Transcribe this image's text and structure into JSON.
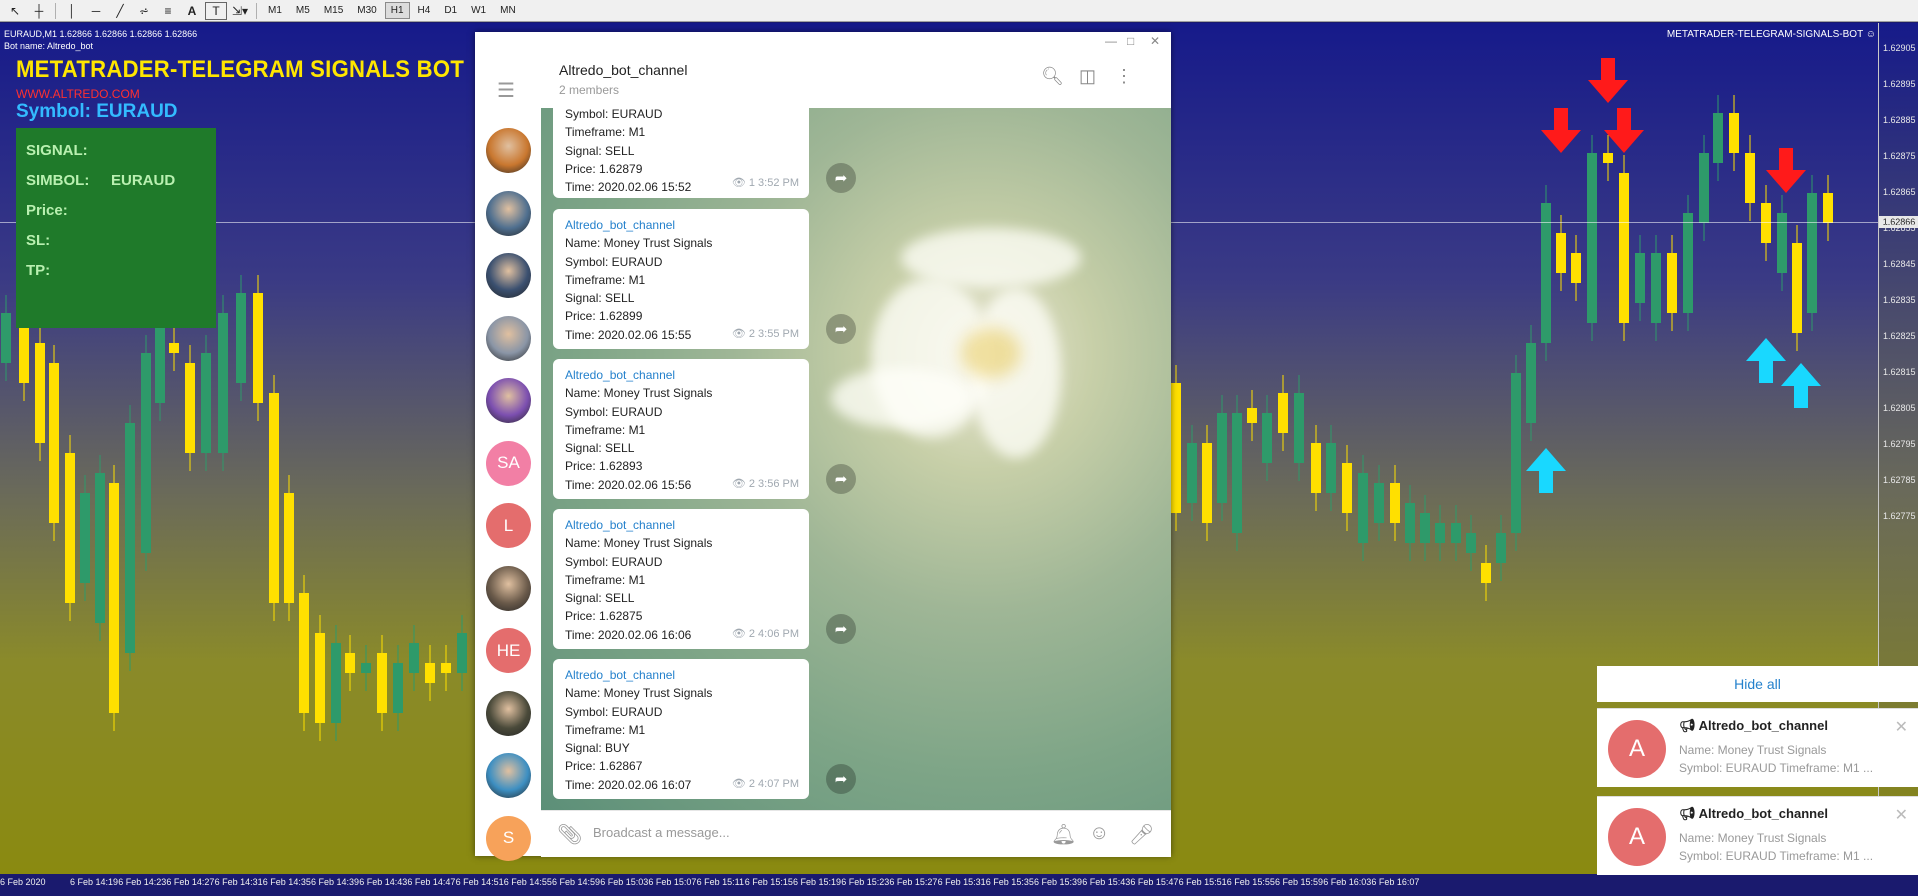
{
  "toolbar": {
    "tools": [
      "cursor-icon",
      "crosshair-icon",
      "vertical-line-icon",
      "horizontal-line-icon",
      "trendline-icon",
      "fibonacci-icon",
      "channel-icon",
      "text-icon",
      "text-label-icon",
      "arrows-icon"
    ],
    "timeframes": [
      "M1",
      "M5",
      "M15",
      "M30",
      "H1",
      "H4",
      "D1",
      "W1",
      "MN"
    ],
    "active_timeframe": "H1"
  },
  "chart": {
    "info_line": "EURAUD,M1  1.62866 1.62866 1.62866 1.62866",
    "bot_name": "Bot name:  Altredo_bot",
    "title": "METATRADER-TELEGRAM SIGNALS BOT",
    "url": "WWW.ALTREDO.COM",
    "symbol": "Symbol: EURAUD",
    "signal_label": "SIGNAL:",
    "simbol_label": "SIMBOL:",
    "simbol_value": "EURAUD",
    "price_label": "Price:",
    "sl_label": "SL:",
    "tp_label": "TP:",
    "corner_label": "METATRADER-TELEGRAM-SIGNALS-BOT ☺",
    "current_price": "1.62866",
    "price_ticks": [
      "1.62905",
      "1.62895",
      "1.62885",
      "1.62875",
      "1.62865",
      "1.62855",
      "1.62845",
      "1.62835",
      "1.62825",
      "1.62815",
      "1.62805",
      "1.62795",
      "1.62785",
      "1.62775"
    ],
    "time_ticks": [
      "6 Feb 2020",
      "6 Feb 14:19",
      "6 Feb 14:23",
      "6 Feb 14:27",
      "6 Feb 14:31",
      "6 Feb 14:35",
      "6 Feb 14:39",
      "6 Feb 14:43",
      "6 Feb 14:47",
      "6 Feb 14:51",
      "6 Feb 14:55",
      "6 Feb 14:59",
      "6 Feb 15:03",
      "6 Feb 15:07",
      "6 Feb 15:11",
      "6 Feb 15:15",
      "6 Feb 15:19",
      "6 Feb 15:23",
      "6 Feb 15:27",
      "6 Feb 15:31",
      "6 Feb 15:35",
      "6 Feb 15:39",
      "6 Feb 15:43",
      "6 Feb 15:47",
      "6 Feb 15:51",
      "6 Feb 15:55",
      "6 Feb 15:59",
      "6 Feb 16:03",
      "6 Feb 16:07"
    ],
    "up_color": "#2e9a6a",
    "down_color": "#ffe000"
  },
  "telegram": {
    "channel_name": "Altredo_bot_channel",
    "members": "2 members",
    "avatars": [
      {
        "kind": "photo",
        "color": "#c9772f"
      },
      {
        "kind": "photo",
        "color": "#4f6f8f"
      },
      {
        "kind": "photo",
        "color": "#3b5070"
      },
      {
        "kind": "photo",
        "color": "#8a95a6"
      },
      {
        "kind": "photo",
        "color": "#7c4fb0"
      },
      {
        "kind": "initials",
        "text": "SA",
        "color": "#f27fa5"
      },
      {
        "kind": "initials",
        "text": "L",
        "color": "#e46d6d"
      },
      {
        "kind": "photo",
        "color": "#6a5a4a"
      },
      {
        "kind": "initials",
        "text": "HE",
        "color": "#e46d6d"
      },
      {
        "kind": "photo",
        "color": "#4a4a3a"
      },
      {
        "kind": "photo",
        "color": "#3d8fc2"
      },
      {
        "kind": "initials",
        "text": "S",
        "color": "#f7a25a"
      }
    ],
    "messages": [
      {
        "author": "",
        "lines": [
          "Symbol: EURAUD",
          "Timeframe: M1",
          "Signal: SELL",
          "Price: 1.62879",
          "Time: 2020.02.06 15:52"
        ],
        "views": "1",
        "time": "3:52 PM"
      },
      {
        "author": "Altredo_bot_channel",
        "lines": [
          "Name: Money Trust Signals",
          "Symbol: EURAUD",
          "Timeframe: M1",
          "Signal: SELL",
          "Price: 1.62899",
          "Time: 2020.02.06 15:55"
        ],
        "views": "2",
        "time": "3:55 PM"
      },
      {
        "author": "Altredo_bot_channel",
        "lines": [
          "Name: Money Trust Signals",
          "Symbol: EURAUD",
          "Timeframe: M1",
          "Signal: SELL",
          "Price: 1.62893",
          "Time: 2020.02.06 15:56"
        ],
        "views": "2",
        "time": "3:56 PM"
      },
      {
        "author": "Altredo_bot_channel",
        "lines": [
          "Name: Money Trust Signals",
          "Symbol: EURAUD",
          "Timeframe: M1",
          "Signal: SELL",
          "Price: 1.62875",
          "Time: 2020.02.06 16:06"
        ],
        "views": "2",
        "time": "4:06 PM"
      },
      {
        "author": "Altredo_bot_channel",
        "lines": [
          "Name: Money Trust Signals",
          "Symbol: EURAUD",
          "Timeframe: M1",
          "Signal: BUY",
          "Price: 1.62867",
          "Time: 2020.02.06 16:07"
        ],
        "views": "2",
        "time": "4:07 PM"
      }
    ],
    "input_placeholder": "Broadcast a message..."
  },
  "notifications": {
    "hide_all": "Hide all",
    "items": [
      {
        "avatar": "A",
        "title": "Altredo_bot_channel",
        "line1": "Name: Money Trust Signals",
        "line2": "Symbol: EURAUD Timeframe: M1 ..."
      },
      {
        "avatar": "A",
        "title": "Altredo_bot_channel",
        "line1": "Name: Money Trust Signals",
        "line2": "Symbol: EURAUD Timeframe: M1 ..."
      }
    ]
  }
}
